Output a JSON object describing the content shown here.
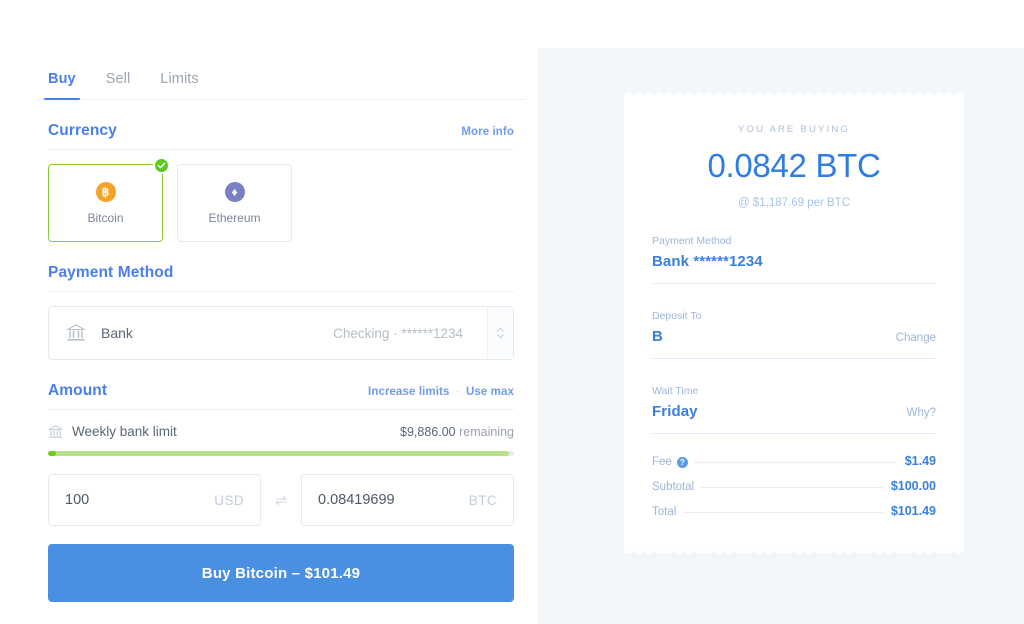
{
  "tabs": [
    {
      "label": "Buy",
      "active": true
    },
    {
      "label": "Sell",
      "active": false
    },
    {
      "label": "Limits",
      "active": false
    }
  ],
  "currency_section": {
    "title": "Currency",
    "more_info": "More info",
    "options": [
      {
        "name": "Bitcoin",
        "symbol": "฿",
        "selected": true
      },
      {
        "name": "Ethereum",
        "symbol": "♦",
        "selected": false
      }
    ]
  },
  "payment_section": {
    "title": "Payment Method",
    "selected_name": "Bank",
    "selected_detail": "Checking · ******1234"
  },
  "amount_section": {
    "title": "Amount",
    "increase_limits": "Increase limits",
    "separator": "·",
    "use_max": "Use max",
    "limit_label": "Weekly bank limit",
    "limit_value": "$9,886.00",
    "limit_suffix": "remaining",
    "limit_percent": 99,
    "fiat_value": "100",
    "fiat_currency": "USD",
    "swap_icon": "⇌",
    "crypto_value": "0.08419699",
    "crypto_currency": "BTC"
  },
  "cta": {
    "label": "Buy Bitcoin – $101.49"
  },
  "receipt": {
    "eyebrow": "YOU ARE BUYING",
    "amount": "0.0842 BTC",
    "rate": "@ $1,187.69 per BTC",
    "fields": [
      {
        "label": "Payment Method",
        "value": "Bank ******1234",
        "action": ""
      },
      {
        "label": "Deposit To",
        "value": "B",
        "action": "Change"
      },
      {
        "label": "Wait Time",
        "value": "Friday",
        "action": "Why?"
      }
    ],
    "totals": [
      {
        "label": "Fee",
        "info": "?",
        "value": "$1.49"
      },
      {
        "label": "Subtotal",
        "info": "",
        "value": "$100.00"
      },
      {
        "label": "Total",
        "info": "",
        "value": "$101.49"
      }
    ]
  },
  "colors": {
    "accent_blue": "#4a90e2",
    "link_blue": "#4a7fe8",
    "select_green": "#86c93a",
    "badge_green": "#5cc924",
    "bitcoin_orange": "#f7a224",
    "ethereum_purple": "#7a80c4",
    "panel_bg": "#f4f7fa"
  }
}
